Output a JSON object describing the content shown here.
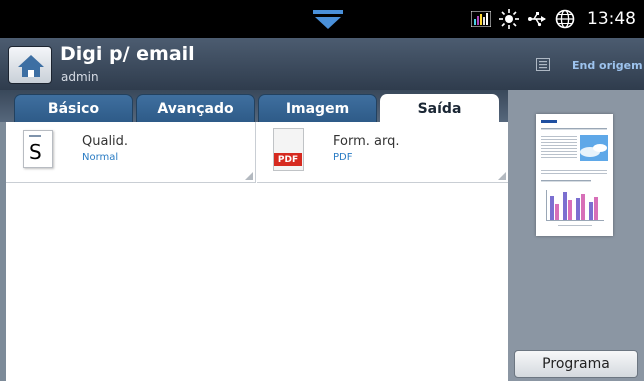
{
  "status_bar": {
    "time": "13:48",
    "icons": [
      "signal-bars-icon",
      "sun-icon",
      "usb-icon",
      "globe-icon"
    ]
  },
  "header": {
    "title": "Digi p/ email",
    "subtitle": "admin",
    "end_label": "End origem",
    "home_icon": "home-icon"
  },
  "tabs": [
    {
      "label": "Básico",
      "active": false
    },
    {
      "label": "Avançado",
      "active": false
    },
    {
      "label": "Imagem",
      "active": false
    },
    {
      "label": "Saída",
      "active": true
    }
  ],
  "options": [
    {
      "label": "Qualid.",
      "value": "Normal",
      "icon": "document-s-icon"
    },
    {
      "label": "Form. arq.",
      "value": "PDF",
      "icon": "pdf-file-icon",
      "badge": "PDF"
    }
  ],
  "side_panel": {
    "button_label": "Programa"
  },
  "colors": {
    "header_bg": "#3d4b5e",
    "tab_bg": "#3a6b9b",
    "value_text": "#2a7cc4",
    "pdf_badge": "#d62a20"
  }
}
